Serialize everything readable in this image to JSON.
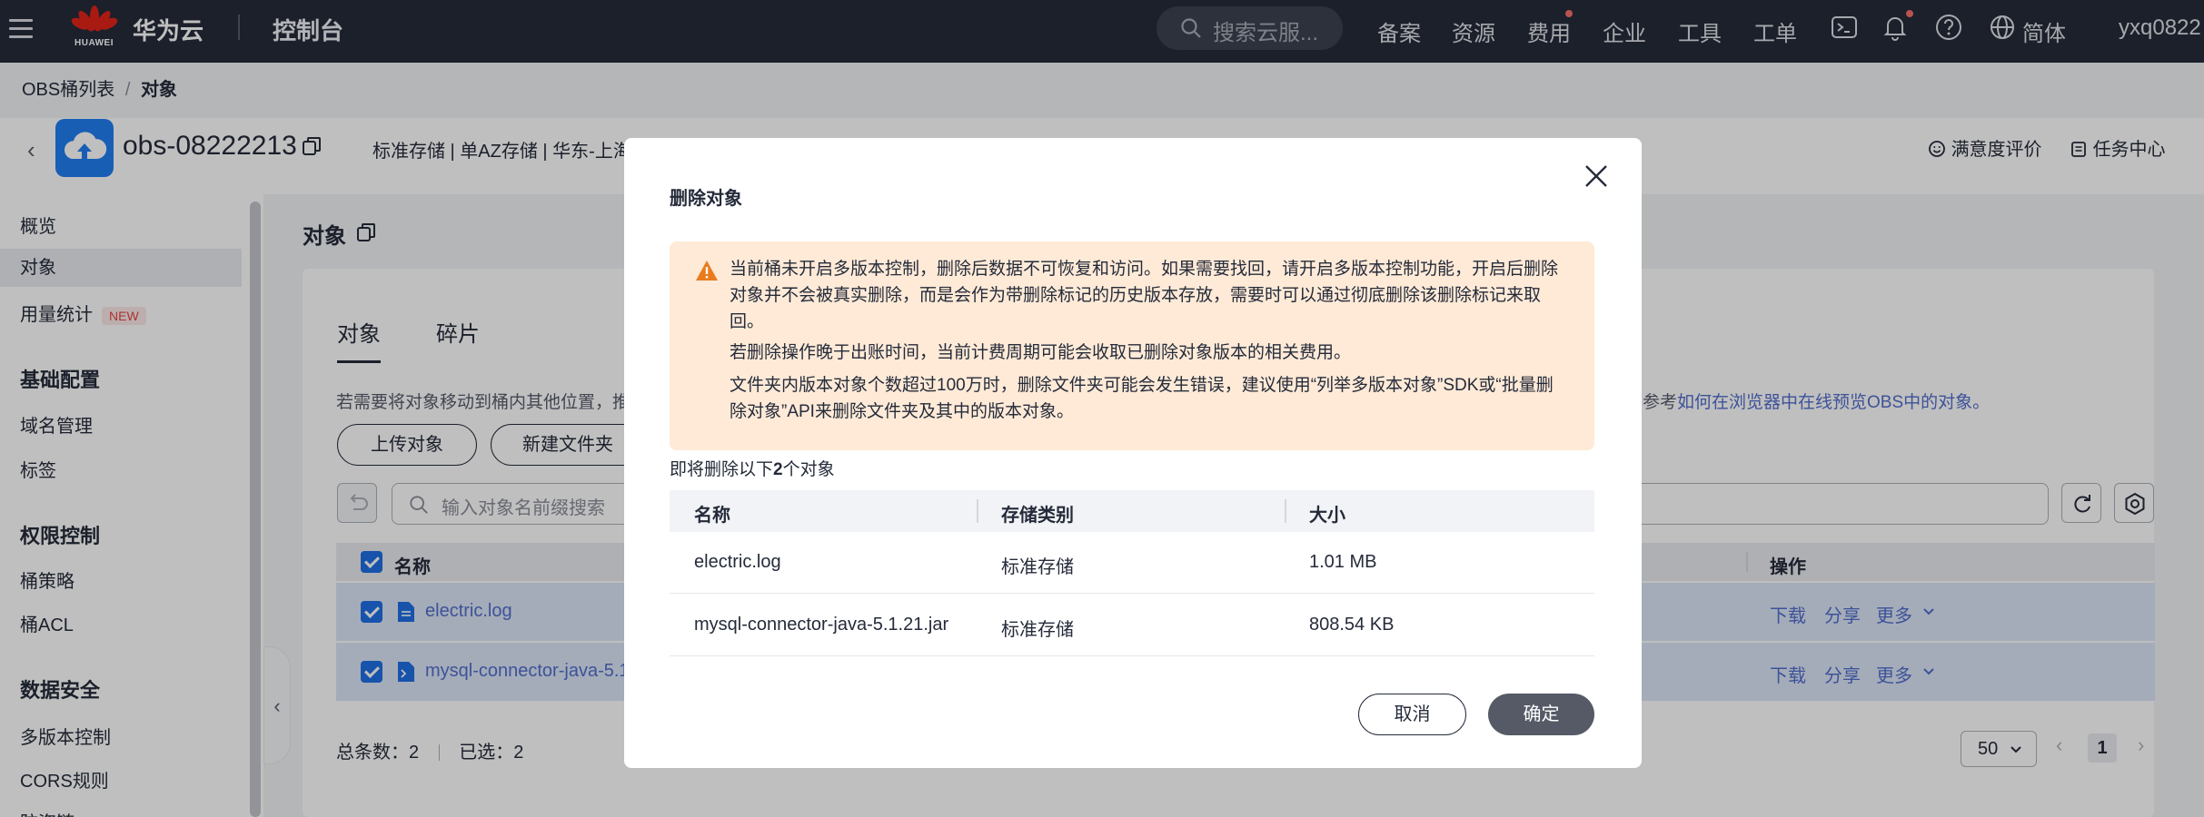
{
  "topbar": {
    "brand": "华为云",
    "logo_word": "HUAWEI",
    "console": "控制台",
    "search_placeholder": "搜索云服...",
    "nav": [
      "备案",
      "资源",
      "费用",
      "企业",
      "工具",
      "工单"
    ],
    "language": "简体",
    "user": "yxq0822"
  },
  "breadcrumb": {
    "parent": "OBS桶列表",
    "separator": "/",
    "current": "对象"
  },
  "bucket": {
    "name": "obs-08222213",
    "meta": "标准存储 | 单AZ存储 | 华东-上海",
    "satisfaction": "满意度评价",
    "task_center": "任务中心"
  },
  "sidebar": {
    "items": [
      {
        "label": "概览"
      },
      {
        "label": "对象"
      },
      {
        "label": "用量统计",
        "badge": "NEW"
      }
    ],
    "group1": {
      "title": "基础配置",
      "items": [
        "域名管理",
        "标签"
      ]
    },
    "group2": {
      "title": "权限控制",
      "items": [
        "桶策略",
        "桶ACL"
      ]
    },
    "group3": {
      "title": "数据安全",
      "items": [
        "多版本控制",
        "CORS规则",
        "防盗链"
      ]
    }
  },
  "main": {
    "title": "对象",
    "tabs": [
      "对象",
      "碎片"
    ],
    "hint": "若需要将对象移动到桶内其他位置，推",
    "hint_link_prefix": "参考",
    "hint_link": "如何在浏览器中在线预览OBS中的对象。",
    "upload_button": "上传对象",
    "new_folder_button": "新建文件夹",
    "filter_placeholder": "输入对象名前缀搜索",
    "col_name": "名称",
    "col_ops": "操作",
    "rows": [
      {
        "name": "electric.log",
        "ops": [
          "下载",
          "分享",
          "更多"
        ]
      },
      {
        "name": "mysql-connector-java-5.1.",
        "ops": [
          "下载",
          "分享",
          "更多"
        ]
      }
    ],
    "total": "总条数：2",
    "selected": "已选：2",
    "page_size": "50",
    "page": "1"
  },
  "dialog": {
    "title": "删除对象",
    "warning_lines": [
      "当前桶未开启多版本控制，删除后数据不可恢复和访问。如果需要找回，请开启多版本控制功能，开启后删除对象并不会被真实删除，而是会作为带删除标记的历史版本存放，需要时可以通过彻底删除该删除标记来取回。",
      "若删除操作晚于出账时间，当前计费周期可能会收取已删除对象版本的相关费用。",
      "文件夹内版本对象个数超过100万时，删除文件夹可能会发生错误，建议使用“列举多版本对象”SDK或“批量删除对象”API来删除文件夹及其中的版本对象。"
    ],
    "summary_pre": "即将删除以下",
    "summary_count": "2",
    "summary_post": "个对象",
    "columns": [
      "名称",
      "存储类别",
      "大小"
    ],
    "rows": [
      {
        "name": "electric.log",
        "class": "标准存储",
        "size": "1.01 MB"
      },
      {
        "name": "mysql-connector-java-5.1.21.jar",
        "class": "标准存储",
        "size": "808.54 KB"
      }
    ],
    "cancel": "取消",
    "confirm": "确定"
  }
}
